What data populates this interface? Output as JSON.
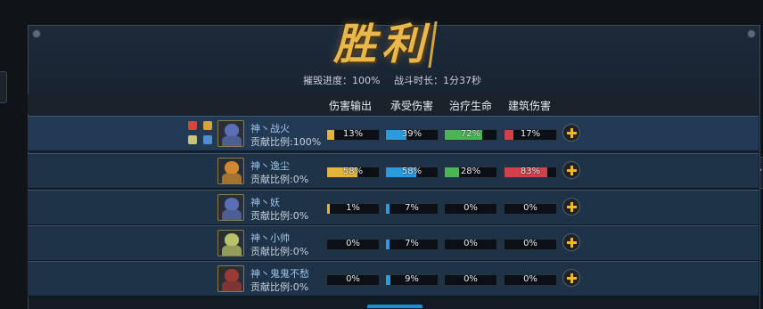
{
  "title": "胜利",
  "summary": {
    "destroy_progress": "摧毁进度：100%",
    "battle_duration": "战斗时长：1分37秒"
  },
  "columns": [
    "伤害输出",
    "承受伤害",
    "治疗生命",
    "建筑伤害"
  ],
  "players": [
    {
      "name": "神丶战火",
      "contribution": "贡献比例:100%",
      "avatar_color": "#5a6fb6",
      "stats": [
        {
          "label": "13%",
          "value": 13
        },
        {
          "label": "39%",
          "value": 39
        },
        {
          "label": "72%",
          "value": 72
        },
        {
          "label": "17%",
          "value": 17
        }
      ],
      "badges": [
        "heart-medal-icon",
        "crown-medal-icon",
        "sword-medal-icon",
        "shield-medal-icon"
      ]
    },
    {
      "name": "神丶逸尘",
      "contribution": "贡献比例:0%",
      "avatar_color": "#d0892e",
      "stats": [
        {
          "label": "58%",
          "value": 58
        },
        {
          "label": "58%",
          "value": 58
        },
        {
          "label": "28%",
          "value": 28
        },
        {
          "label": "83%",
          "value": 83
        }
      ],
      "badges": []
    },
    {
      "name": "神丶妖",
      "contribution": "贡献比例:0%",
      "avatar_color": "#5a6fb6",
      "stats": [
        {
          "label": "1%",
          "value": 1
        },
        {
          "label": "7%",
          "value": 7
        },
        {
          "label": "0%",
          "value": 0
        },
        {
          "label": "0%",
          "value": 0
        }
      ],
      "badges": []
    },
    {
      "name": "神丶小帅",
      "contribution": "贡献比例:0%",
      "avatar_color": "#b8c26a",
      "stats": [
        {
          "label": "0%",
          "value": 0
        },
        {
          "label": "7%",
          "value": 7
        },
        {
          "label": "0%",
          "value": 0
        },
        {
          "label": "0%",
          "value": 0
        }
      ],
      "badges": []
    },
    {
      "name": "神丶鬼鬼不愁",
      "contribution": "贡献比例:0%",
      "avatar_color": "#9a3a36",
      "stats": [
        {
          "label": "0%",
          "value": 0
        },
        {
          "label": "9%",
          "value": 9
        },
        {
          "label": "0%",
          "value": 0
        },
        {
          "label": "0%",
          "value": 0
        }
      ],
      "badges": []
    }
  ],
  "colors": {
    "damage": "#e2b53a",
    "taken": "#2b9be0",
    "heal": "#49b554",
    "building": "#d2404a",
    "title_gold": "#e8b94a"
  }
}
